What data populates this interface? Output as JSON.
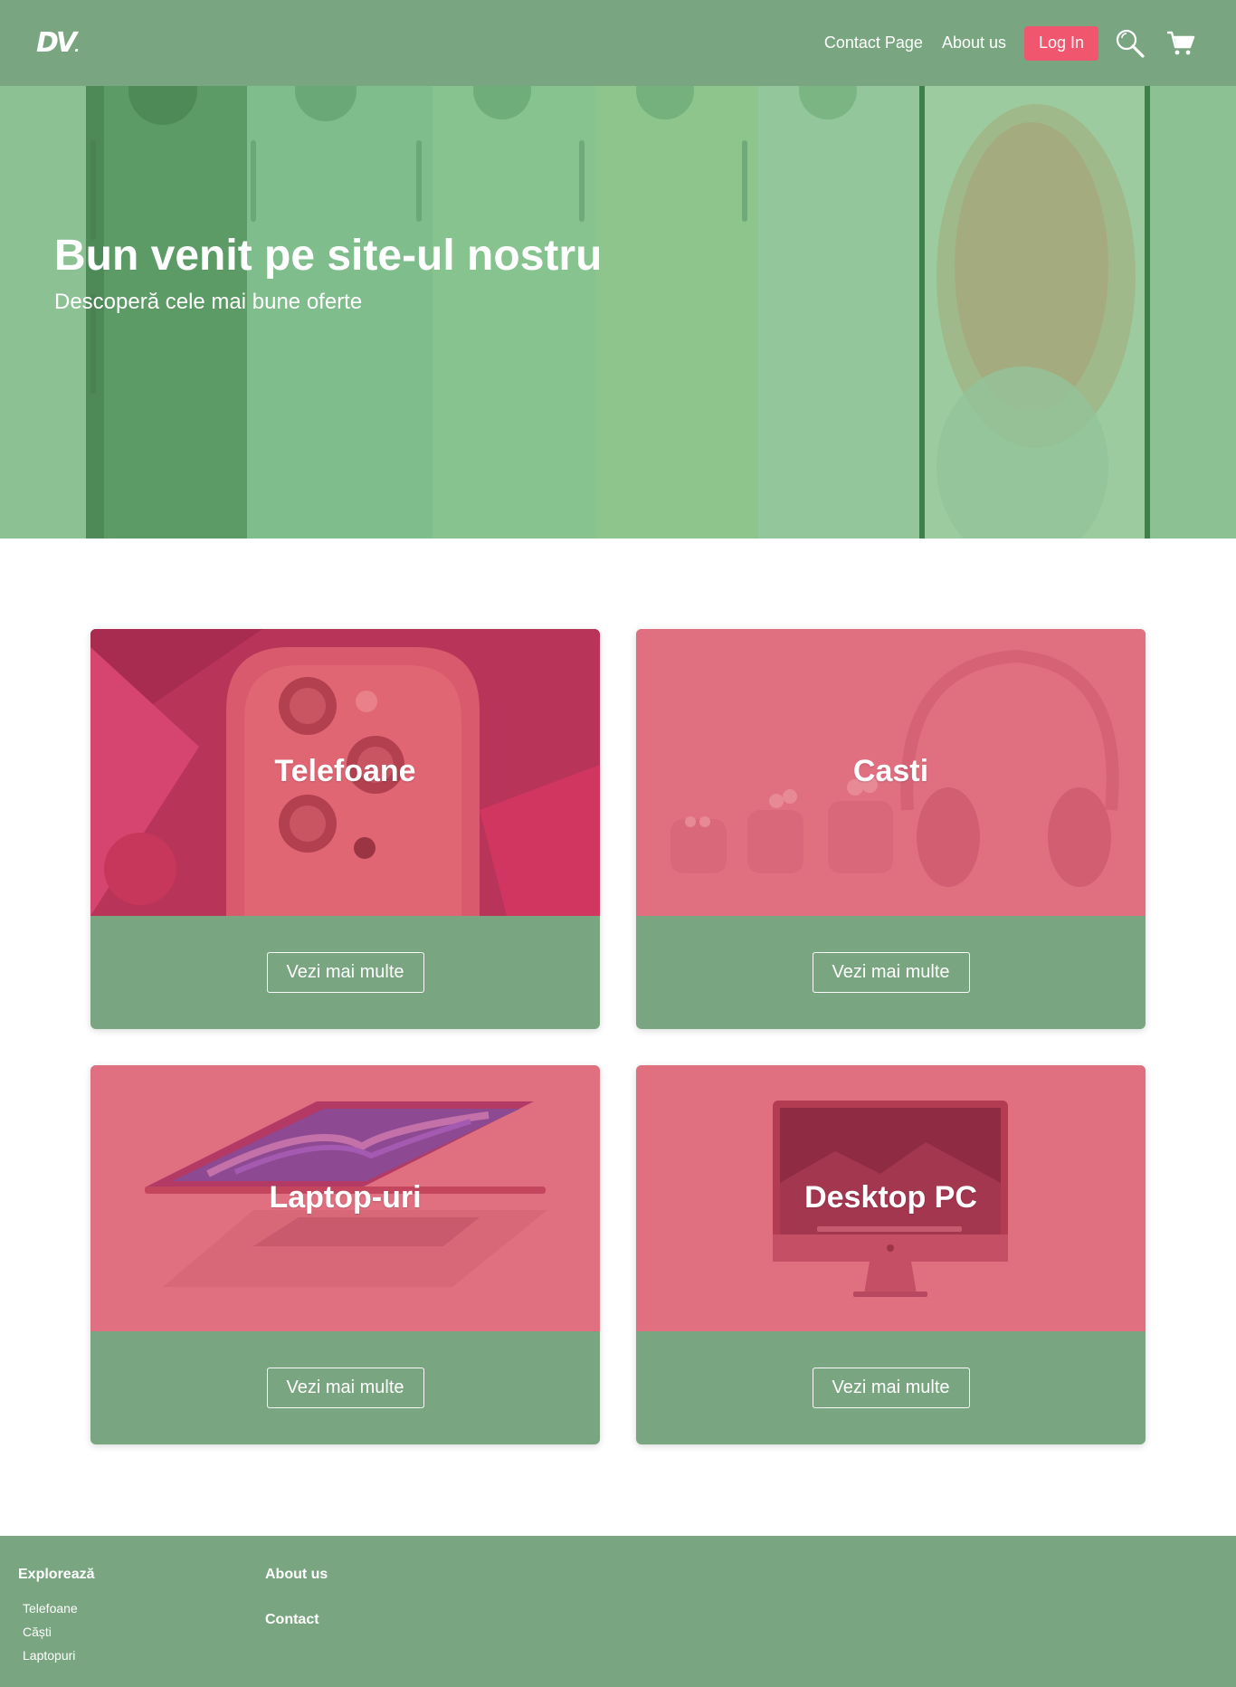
{
  "header": {
    "logo_text": "DV",
    "nav": {
      "contact_label": "Contact Page",
      "about_label": "About us",
      "login_label": "Log In"
    },
    "icons": [
      "search-icon",
      "cart-icon"
    ]
  },
  "hero": {
    "title": "Bun venit pe site-ul nostru",
    "subtitle": "Descoperă cele mai bune oferte"
  },
  "categories": [
    {
      "title": "Telefoane",
      "button_label": "Vezi mai multe"
    },
    {
      "title": "Casti",
      "button_label": "Vezi mai multe"
    },
    {
      "title": "Laptop-uri",
      "button_label": "Vezi mai multe"
    },
    {
      "title": "Desktop PC",
      "button_label": "Vezi mai multe"
    }
  ],
  "footer": {
    "explore_heading": "Explorează",
    "explore_links": [
      "Telefoane",
      "Căști",
      "Laptopuri"
    ],
    "about_label": "About us",
    "contact_label": "Contact"
  },
  "colors": {
    "brand_green": "#79a681",
    "hero_green": "#8cc194",
    "accent_red": "#f0566d",
    "card_pink": "#e07080"
  }
}
